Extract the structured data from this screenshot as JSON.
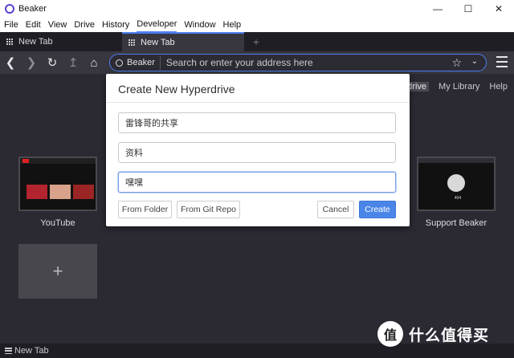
{
  "window": {
    "title": "Beaker",
    "controls": [
      "—",
      "☐",
      "✕"
    ]
  },
  "menu": [
    "File",
    "Edit",
    "View",
    "Drive",
    "History",
    "Developer",
    "Window",
    "Help"
  ],
  "tabs": [
    {
      "label": "New Tab"
    },
    {
      "label": "New Tab"
    }
  ],
  "newtab_plus": "+",
  "address": {
    "site": "Beaker",
    "placeholder": "Search or enter your address here"
  },
  "top_links": {
    "hyperdrive": "perdrive",
    "library": "My Library",
    "help": "Help"
  },
  "tiles": [
    {
      "label": "YouTube"
    },
    {
      "label": "Support Beaker"
    }
  ],
  "add_tile": "+",
  "support_thumb_caption": "404",
  "dialog": {
    "title": "Create New Hyperdrive",
    "title_field": "雷锋哥的共享",
    "description_field": "资料",
    "third_field": "嘿嘿",
    "buttons": {
      "from_folder": "From Folder",
      "from_git": "From Git Repo",
      "cancel": "Cancel",
      "create": "Create"
    }
  },
  "status_bar": "New Tab",
  "watermark": {
    "badge": "值",
    "text": "什么值得买"
  }
}
